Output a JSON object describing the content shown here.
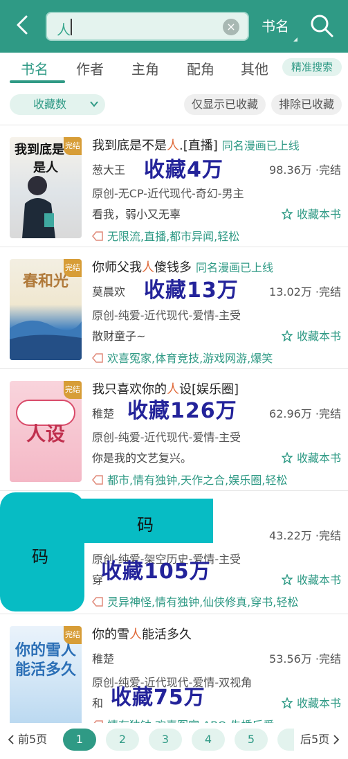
{
  "header": {
    "search_value": "人",
    "clear_glyph": "×",
    "scope_label": "书名"
  },
  "tabs": [
    {
      "label": "书名",
      "active": true
    },
    {
      "label": "作者",
      "active": false
    },
    {
      "label": "主角",
      "active": false
    },
    {
      "label": "配角",
      "active": false
    },
    {
      "label": "其他",
      "active": false
    }
  ],
  "precise_search_label": "精准搜索",
  "filters": {
    "sort_label": "收藏数",
    "only_collected": "仅显示已收藏",
    "exclude_collected": "排除已收藏"
  },
  "books": [
    {
      "cover_title": "我到底是不是人",
      "badge": "完结",
      "title_pre": "我到底是不是",
      "title_hl": "人",
      "title_post": ".[直播]",
      "manhua": "同名漫画已上线",
      "author": "葱大王",
      "words": "98.36万 ·完结",
      "tags": "原创-无CP-近代现代-奇幻-男主",
      "intro": "看我，弱小又无辜",
      "collect": "收藏本书",
      "keywords": "无限流,直播,都市异闻,轻松",
      "overlay": "收藏4万"
    },
    {
      "cover_title": "春和光",
      "badge": "完结",
      "title_pre": "你师父我",
      "title_hl": "人",
      "title_post": "傻钱多",
      "manhua": "同名漫画已上线",
      "author": "莫晨欢",
      "words": "13.02万 ·完结",
      "tags": "原创-纯爱-近代现代-爱情-主受",
      "intro": "散财童子~",
      "collect": "收藏本书",
      "keywords": "欢喜冤家,体育竞技,游戏网游,爆笑",
      "overlay": "收藏13万"
    },
    {
      "cover_title": "人设",
      "badge": "完结",
      "title_pre": "我只喜欢你的",
      "title_hl": "人",
      "title_post": "设[娱乐圈]",
      "manhua": "",
      "author": "稚楚",
      "words": "62.96万 ·完结",
      "tags": "原创-纯爱-近代现代-爱情-主受",
      "intro": "你是我的文艺复兴。",
      "collect": "收藏本书",
      "keywords": "都市,情有独钟,天作之合,娱乐圈,轻松",
      "overlay": "收藏126万"
    },
    {
      "cover_title": "",
      "badge": "",
      "title_pre": "",
      "title_hl": "",
      "title_post": "",
      "manhua": "",
      "author": "",
      "words": "43.22万 ·完结",
      "tags": "原创-纯爱-架空历史-爱情-主受",
      "intro": "穿",
      "collect": "收藏本书",
      "keywords": "灵异神怪,情有独钟,仙侠修真,穿书,轻松",
      "overlay": "收藏105万"
    },
    {
      "cover_title": "你的雪人能活多久",
      "badge": "完结",
      "title_pre": "你的雪",
      "title_hl": "人",
      "title_post": "能活多久",
      "manhua": "",
      "author": "稚楚",
      "words": "53.56万 ·完结",
      "tags": "原创-纯爱-近代现代-爱情-双视角",
      "intro": "和",
      "collect": "收藏本书",
      "keywords": "情有独钟,欢喜冤家,ABO,先婚后爱",
      "overlay": "收藏75万"
    }
  ],
  "mask": {
    "big": "码",
    "small": "码"
  },
  "pager": {
    "prev": "前5页",
    "next": "后5页",
    "pages": [
      "1",
      "2",
      "3",
      "4",
      "5"
    ]
  },
  "colors": {
    "accent": "#2f9a85",
    "highlight": "#e06a3a",
    "overlay": "#23239a",
    "mask": "#07bcc4"
  }
}
